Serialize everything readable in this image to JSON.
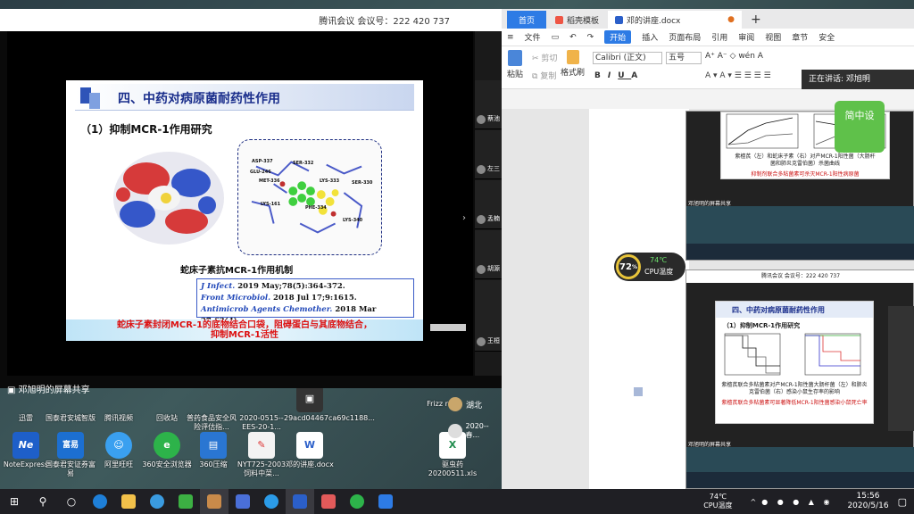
{
  "meeting": {
    "title": "腾讯会议 会议号：222 420 737",
    "share_label": "邓旭明的屏幕共享",
    "participants": [
      "蔡池",
      "左三",
      "孟楠",
      "胡源",
      "王桓"
    ]
  },
  "slide": {
    "title": "四、中药对病原菌耐药性作用",
    "subtitle": "（1）抑制MCR-1作用研究",
    "caption": "蛇床子素抗MCR-1作用机制",
    "refs": [
      {
        "journal": "J Infect.",
        "text": " 2019 May;78(5):364-372."
      },
      {
        "journal": "Front Microbiol.",
        "text": " 2018 Jul 17;9:1615."
      },
      {
        "journal": "Antimicrob Agents Chemother.",
        "text": " 2018 Mar 27;62(4)."
      }
    ],
    "conclusion_line1": "蛇床子素封闭MCR-1的底物结合口袋，阻碍蛋白与其底物结合，",
    "conclusion_line2": "抑制MCR-1活性",
    "residues": [
      "ASP-337",
      "SER-332",
      "GLU-246",
      "MET-336",
      "LYS-333",
      "SER-330",
      "LYS-161",
      "PHE-334",
      "LYS-340"
    ]
  },
  "wps": {
    "tabs": {
      "home": "首页",
      "template": "稻壳模板",
      "doc": "邓的讲座.docx"
    },
    "menu": [
      "文件",
      "开始",
      "插入",
      "页面布局",
      "引用",
      "审阅",
      "视图",
      "章节",
      "安全"
    ],
    "ribbon": {
      "paste": "粘贴",
      "cut": "剪切",
      "copy": "复制",
      "format_painter": "格式刷",
      "font": "Calibri (正文)",
      "size": "五号"
    },
    "speaking": "正在讲话: 邓旭明"
  },
  "mini_slide_top": {
    "caption": "紫檀芪（左）和蛇床子素（右）对产MCR-1阳性菌（大肠杆菌和肺炎克雷伯菌）杀菌曲线",
    "conclusion": "抑制剂联合多粘菌素可杀灭MCR-1阳性病原菌",
    "share": "邓旭明的屏幕共享",
    "badge": "简中设"
  },
  "mini_slide_bottom": {
    "header": "腾讯会议 会议号：222 420 737",
    "title": "四、中药对病原菌耐药性作用",
    "subtitle": "（1）抑制MCR-1作用研究",
    "caption": "紫檀芪联合多粘菌素对产MCR-1阳性菌大肠杆菌（左）和肺炎克雷伯菌（右）感染小鼠生存率的影响",
    "conclusion": "紫檀芪联合多粘菌素可显著降低MCR-1阳性菌感染小鼠死亡率",
    "share": "邓旭明的屏幕共享",
    "participant": "腾讯"
  },
  "cpu": {
    "percent": "72",
    "unit": "%",
    "temp": "74℃",
    "label": "CPU温度"
  },
  "desktop": {
    "row1": [
      "迅雷",
      "国泰君安城智版",
      "腾讯视频",
      "回收站",
      "普药食品安全风险评估指...",
      "2020-0515--EES-20-1...",
      "29acd04467ca69c1188..."
    ],
    "row2": [
      "NoteExpress",
      "国泰君安证券富易",
      "阿里旺旺",
      "360安全浏览器",
      "360压缩",
      "NYT725-2003 饲料中菜...",
      "邓的讲座.docx",
      "驱虫药20200511.xls"
    ],
    "frizzle": "Frizz r",
    "hubei": "湖北",
    "item2020": "2020--春..."
  },
  "taskbar": {
    "temp": "74℃",
    "cpu_label": "CPU温度",
    "time": "15:56",
    "date": "2020/5/16"
  }
}
